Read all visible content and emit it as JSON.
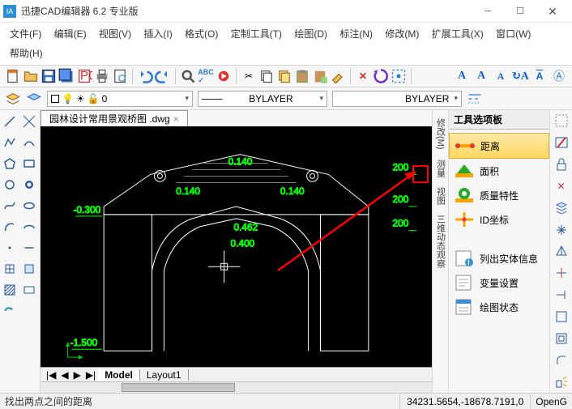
{
  "titlebar": {
    "app_icon": "IA",
    "title": "迅捷CAD编辑器 6.2 专业版"
  },
  "menus": [
    {
      "label": "文件(F)"
    },
    {
      "label": "编辑(E)"
    },
    {
      "label": "视图(V)"
    },
    {
      "label": "插入(I)"
    },
    {
      "label": "格式(O)"
    },
    {
      "label": "定制工具(T)"
    },
    {
      "label": "绘图(D)"
    },
    {
      "label": "标注(N)"
    },
    {
      "label": "修改(M)"
    },
    {
      "label": "扩展工具(X)"
    },
    {
      "label": "窗口(W)"
    },
    {
      "label": "帮助(H)"
    }
  ],
  "layer_combo": {
    "value": "0"
  },
  "linetype_combo1": {
    "value": "BYLAYER"
  },
  "linetype_combo2": {
    "value": "BYLAYER"
  },
  "file_tab": {
    "name": "园林设计常用景观桥图 .dwg",
    "close": "×"
  },
  "layout_tabs": {
    "nav": [
      "|◀",
      "◀",
      "▶",
      "▶|"
    ],
    "tabs": [
      "Model",
      "Layout1"
    ],
    "active": 0
  },
  "side_tabs": [
    "修改(M)",
    "测量",
    "视图",
    "三维动态观察"
  ],
  "palette": {
    "title": "工具选项板",
    "items": [
      {
        "label": "距离",
        "icon": "distance",
        "active": true
      },
      {
        "label": "面积",
        "icon": "area"
      },
      {
        "label": "质量特性",
        "icon": "mass"
      },
      {
        "label": "ID坐标",
        "icon": "id"
      },
      {
        "label": "列出实体信息",
        "icon": "list"
      },
      {
        "label": "变量设置",
        "icon": "vars"
      },
      {
        "label": "绘图状态",
        "icon": "status"
      }
    ]
  },
  "statusbar": {
    "msg": "找出两点之间的距离",
    "coords": "34231.5654,-18678.7191,0",
    "mode": "OpenG"
  },
  "dims": {
    "d1": "0.140",
    "d2": "0.140",
    "d3": "0.140",
    "d4": "-0.300",
    "d5": "-1.500",
    "d6": "0.462",
    "d7": "0.400",
    "d8": "200",
    "d9": "200",
    "d10": "200"
  }
}
